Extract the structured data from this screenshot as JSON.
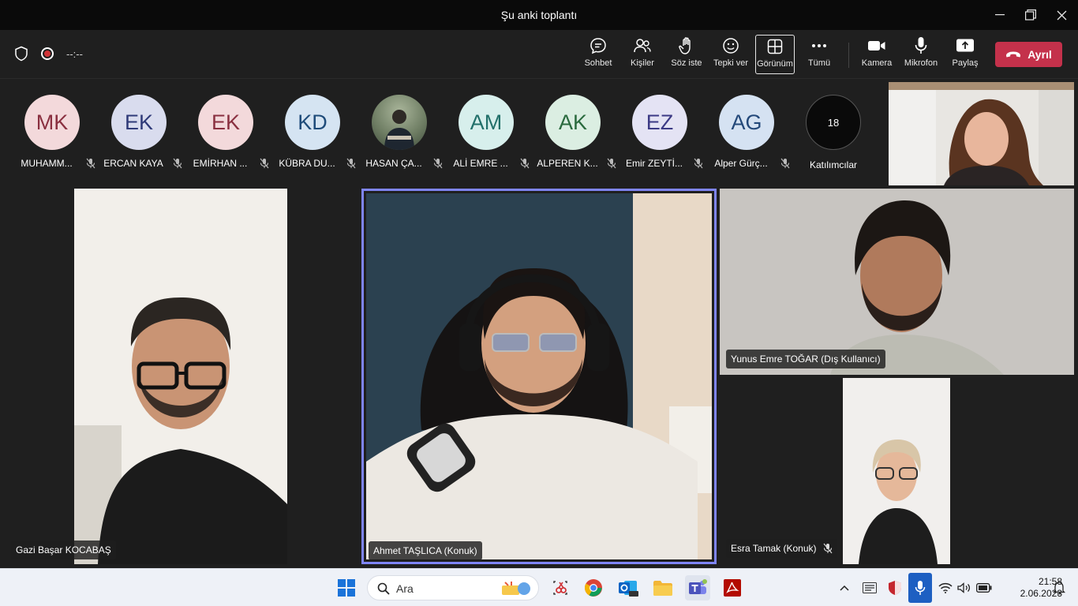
{
  "window": {
    "title": "Şu anki toplantı"
  },
  "meeting": {
    "timer": "--:--"
  },
  "toolbar": {
    "chat": "Sohbet",
    "people": "Kişiler",
    "raise_hand": "Söz iste",
    "react": "Tepki ver",
    "view": "Görünüm",
    "more": "Tümü",
    "camera": "Kamera",
    "mic": "Mikrofon",
    "share": "Paylaş",
    "leave": "Ayrıl"
  },
  "participants": [
    {
      "initials": "MK",
      "name": "MUHAMM...",
      "bg": "#f3d9db",
      "fg": "#8a3040"
    },
    {
      "initials": "EK",
      "name": "ERCAN KAYA",
      "bg": "#d9dcee",
      "fg": "#2f3a78"
    },
    {
      "initials": "EK",
      "name": "EMİRHAN ...",
      "bg": "#f3d9db",
      "fg": "#8a3040"
    },
    {
      "initials": "KD",
      "name": "KÜBRA DU...",
      "bg": "#d5e4f2",
      "fg": "#1f4c7a"
    },
    {
      "initials": "",
      "name": "HASAN ÇA...",
      "bg": "#5a6a5a",
      "fg": "#ffffff"
    },
    {
      "initials": "AM",
      "name": "ALİ EMRE ...",
      "bg": "#d7efec",
      "fg": "#22706a"
    },
    {
      "initials": "AK",
      "name": "ALPEREN K...",
      "bg": "#dbeee2",
      "fg": "#2a6a3e"
    },
    {
      "initials": "EZ",
      "name": "Emir ZEYTİ...",
      "bg": "#e4e3f4",
      "fg": "#3c3a85"
    },
    {
      "initials": "AG",
      "name": "Alper Gürç...",
      "bg": "#d5e2f2",
      "fg": "#24497a"
    }
  ],
  "participants_more": {
    "count": "18",
    "label": "Katılımcılar"
  },
  "tiles": {
    "gazi": "Gazi Başar KOCABAŞ",
    "ahmet": "Ahmet TAŞLICA (Konuk)",
    "yunus": "Yunus Emre TOĞAR (Dış Kullanıcı)",
    "esra": "Esra Tamak (Konuk)"
  },
  "taskbar": {
    "search_placeholder": "Ara",
    "time": "21:58",
    "date": "2.06.2023"
  }
}
